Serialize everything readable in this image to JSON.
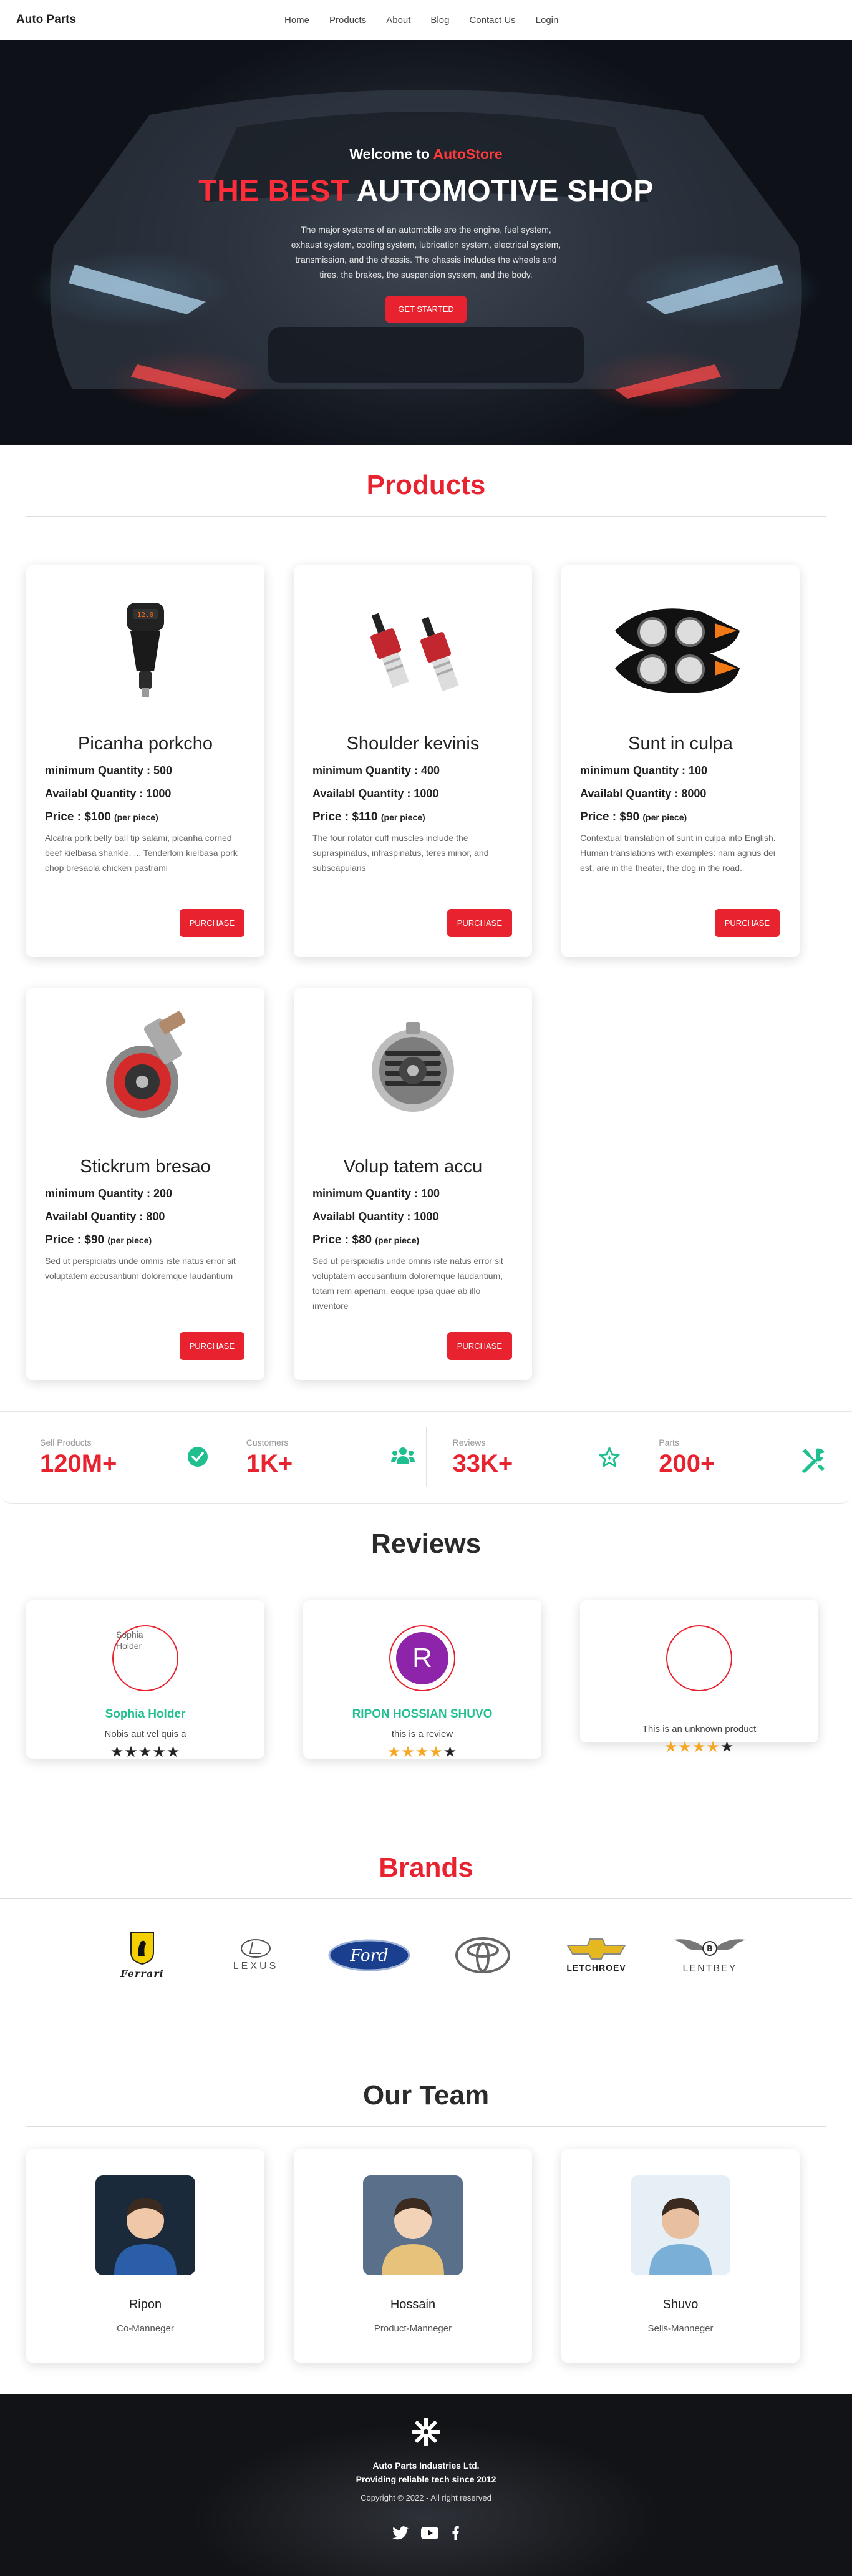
{
  "nav": {
    "brand": "Auto Parts",
    "links": [
      "Home",
      "Products",
      "About",
      "Blog",
      "Contact Us",
      "Login"
    ]
  },
  "hero": {
    "welcome_prefix": "Welcome to ",
    "welcome_brand": "AutoStore",
    "title_accent": "THE BEST",
    "title_rest": " AUTOMOTIVE SHOP",
    "description": "The major systems of an automobile are the engine, fuel system, exhaust system, cooling system, lubrication system, electrical system, transmission, and the chassis. The chassis includes the wheels and tires, the brakes, the suspension system, and the body.",
    "cta": "GET STARTED"
  },
  "products": {
    "title": "Products",
    "min_label": "minimum Quantity : ",
    "avail_label": "Availabl Quantity : ",
    "price_label": "Price : ",
    "per_piece": "(per piece)",
    "button": "PURCHASE",
    "items": [
      {
        "name": "Picanha porkcho",
        "min": "500",
        "avail": "1000",
        "price": "$100",
        "desc": "Alcatra pork belly ball tip salami, picanha corned beef kielbasa shankle. ... Tenderloin kielbasa pork chop bresaola chicken pastrami",
        "icon": "car-charger-icon"
      },
      {
        "name": "Shoulder kevinis",
        "min": "400",
        "avail": "1000",
        "price": "$110",
        "desc": "The four rotator cuff muscles include the supraspinatus, infraspinatus, teres minor, and subscapularis",
        "icon": "led-bulbs-icon"
      },
      {
        "name": "Sunt in culpa",
        "min": "100",
        "avail": "8000",
        "price": "$90",
        "desc": "Contextual translation of sunt in culpa into English. Human translations with examples: nam agnus dei est, are in the theater, the dog in the road.",
        "icon": "headlights-icon"
      },
      {
        "name": "Stickrum bresao",
        "min": "200",
        "avail": "800",
        "price": "$90",
        "desc": "Sed ut perspiciatis unde omnis iste natus error sit voluptatem accusantium doloremque laudantium",
        "icon": "turbocharger-icon"
      },
      {
        "name": "Volup tatem accu",
        "min": "100",
        "avail": "1000",
        "price": "$80",
        "desc": "Sed ut perspiciatis unde omnis iste natus error sit voluptatem accusantium doloremque laudantium, totam rem aperiam, eaque ipsa quae ab illo inventore",
        "icon": "alternator-icon"
      }
    ]
  },
  "stats": [
    {
      "label": "Sell Products",
      "value": "120M+",
      "icon": "check-circle-icon",
      "color": "#1fbf8f"
    },
    {
      "label": "Customers",
      "value": "1K+",
      "icon": "users-icon",
      "color": "#1fbf8f"
    },
    {
      "label": "Reviews",
      "value": "33K+",
      "icon": "star-outline-icon",
      "color": "#1fbf8f"
    },
    {
      "label": "Parts",
      "value": "200+",
      "icon": "tools-icon",
      "color": "#1fbf8f"
    }
  ],
  "reviews": {
    "title": "Reviews",
    "items": [
      {
        "avatar_alt": "Sophia Holder",
        "avatar_letter": "",
        "name": "Sophia Holder",
        "text": "Nobis aut vel quis a",
        "rating": 5,
        "star_color": "#222"
      },
      {
        "avatar_alt": "",
        "avatar_letter": "R",
        "name": "RIPON HOSSIAN SHUVO",
        "text": "this is a review",
        "rating": 4,
        "star_color": "#f5a623"
      },
      {
        "avatar_alt": "",
        "avatar_letter": "",
        "name": "",
        "text": "This is an unknown product",
        "rating": 4,
        "star_color": "#f5a623"
      }
    ]
  },
  "brands": {
    "title": "Brands",
    "items": [
      {
        "name": "Ferrari",
        "icon": "ferrari-logo"
      },
      {
        "name": "LEXUS",
        "icon": "lexus-logo"
      },
      {
        "name": "Ford",
        "icon": "ford-logo"
      },
      {
        "name": "Toyota",
        "icon": "toyota-logo"
      },
      {
        "name": "LETCHROEV",
        "icon": "chevrolet-logo"
      },
      {
        "name": "LENTBEY",
        "icon": "bentley-logo"
      }
    ]
  },
  "team": {
    "title": "Our Team",
    "members": [
      {
        "name": "Ripon",
        "role": "Co-Manneger"
      },
      {
        "name": "Hossain",
        "role": "Product-Manneger"
      },
      {
        "name": "Shuvo",
        "role": "Sells-Manneger"
      }
    ]
  },
  "footer": {
    "company": "Auto Parts Industries Ltd.",
    "tagline": "Providing reliable tech since 2012",
    "copyright": "Copyright © 2022 - All right reserved",
    "social": [
      "twitter-icon",
      "youtube-icon",
      "facebook-icon"
    ]
  },
  "colors": {
    "accent": "#e8232f",
    "success": "#1fbf8f",
    "star": "#f5a623"
  }
}
